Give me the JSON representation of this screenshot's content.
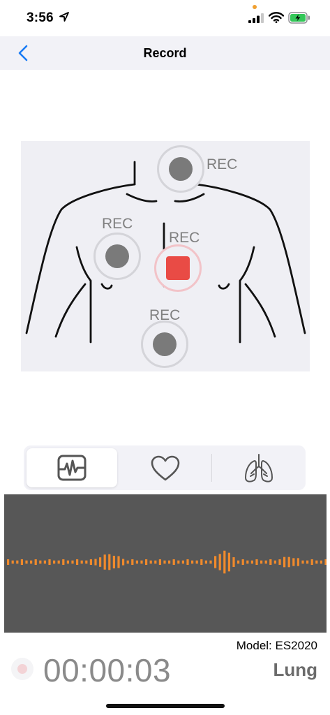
{
  "status_bar": {
    "time": "3:56",
    "icons": [
      "location-arrow-icon",
      "cellular-signal-icon",
      "wifi-icon",
      "battery-charging-icon"
    ]
  },
  "nav": {
    "title": "Record",
    "back_icon": "chevron-left-icon"
  },
  "diagram": {
    "points": [
      {
        "id": "neck",
        "label": "REC",
        "state": "idle"
      },
      {
        "id": "right-chest",
        "label": "REC",
        "state": "idle"
      },
      {
        "id": "center",
        "label": "REC",
        "state": "recording"
      },
      {
        "id": "lower",
        "label": "REC",
        "state": "idle"
      }
    ]
  },
  "tabs": [
    {
      "name": "waveform",
      "icon": "waveform-monitor-icon",
      "selected": true
    },
    {
      "name": "heart",
      "icon": "heart-icon",
      "selected": false
    },
    {
      "name": "lung",
      "icon": "lungs-icon",
      "selected": false
    }
  ],
  "waveform": {
    "color": "#f08a2c",
    "background": "#575757"
  },
  "footer": {
    "model": "Model: ES2020",
    "timer": "00:00:03",
    "mode": "Lung"
  },
  "colors": {
    "accent_blue": "#1a7cf5",
    "record_red": "#e94b45",
    "waveform_orange": "#f08a2c"
  }
}
